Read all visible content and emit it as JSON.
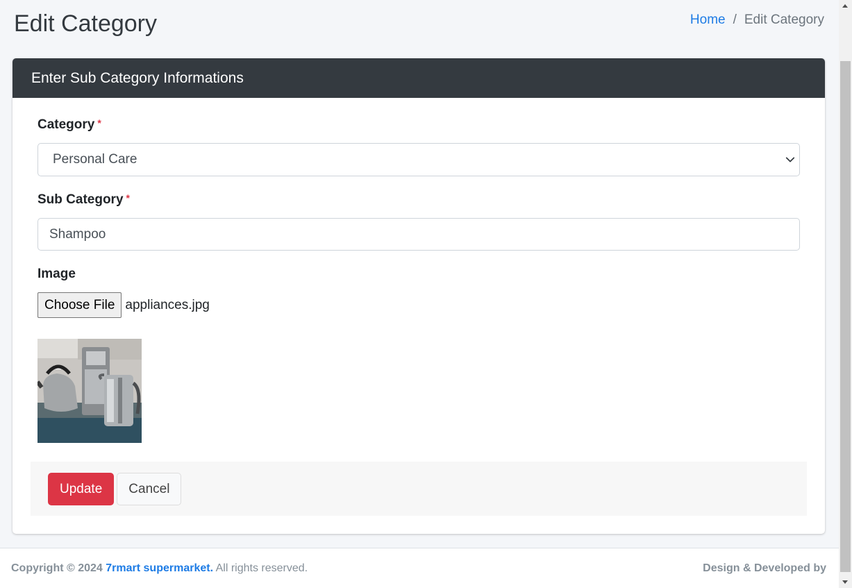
{
  "page": {
    "title": "Edit Category",
    "breadcrumb": {
      "home": "Home",
      "separator": "/",
      "current": "Edit Category"
    }
  },
  "card": {
    "header": "Enter Sub Category Informations",
    "category": {
      "label": "Category",
      "required_mark": "*",
      "selected": "Personal Care"
    },
    "sub_category": {
      "label": "Sub Category",
      "required_mark": "*",
      "value": "Shampoo"
    },
    "image": {
      "label": "Image",
      "button": "Choose File",
      "file_name": "appliances.jpg"
    },
    "actions": {
      "update": "Update",
      "cancel": "Cancel"
    }
  },
  "footer": {
    "copyright": "Copyright © 2024",
    "brand": "7rmart supermarket.",
    "rights": "All rights reserved.",
    "credit": "Design & Developed by"
  },
  "colors": {
    "header_bg": "#343a40",
    "primary_link": "#1e7ce5",
    "danger": "#dc3545"
  },
  "icons": {
    "select": "chevron-down-icon"
  }
}
